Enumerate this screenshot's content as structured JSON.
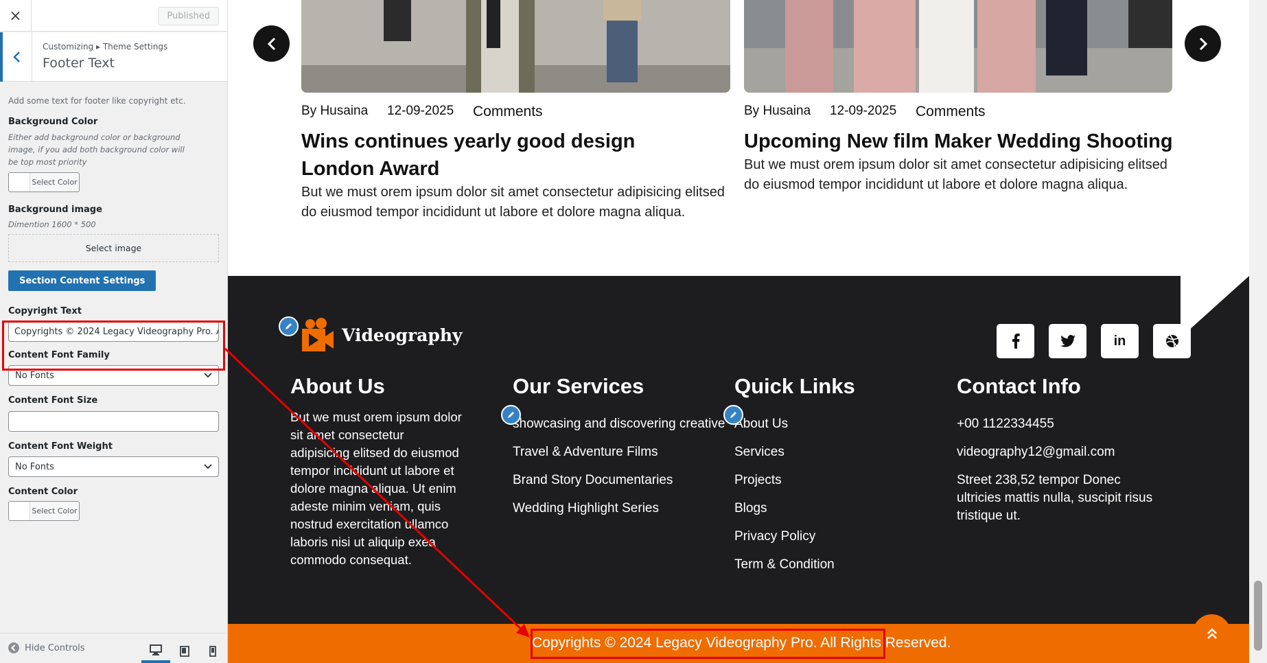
{
  "sidebar": {
    "close_label": "×",
    "publish_label": "Published",
    "breadcrumb": "Customizing ▸ Theme Settings",
    "section_title": "Footer Text",
    "description": "Add some text for footer like copyright etc.",
    "background_color": {
      "label": "Background Color",
      "note": "Either add background color or background image, if you add both background color will be top most priority",
      "button_label": "Select Color"
    },
    "background_image": {
      "label": "Background image",
      "note": "Dimention 1600 * 500",
      "button_label": "Select image"
    },
    "section_settings_button": "Section Content Settings",
    "copyright": {
      "label": "Copyright Text",
      "value": "Copyrights © 2024 Legacy Videography Pro. All Rights Reserved."
    },
    "font_family": {
      "label": "Content Font Family",
      "value": "No Fonts"
    },
    "font_size": {
      "label": "Content Font Size",
      "value": ""
    },
    "font_weight": {
      "label": "Content Font Weight",
      "value": "No Fonts"
    },
    "content_color": {
      "label": "Content Color",
      "button_label": "Select Color"
    },
    "hide_controls_label": "Hide Controls",
    "devices": [
      "desktop-icon",
      "tablet-icon",
      "mobile-icon"
    ]
  },
  "posts": [
    {
      "author": "By Husaina",
      "date": "12-09-2025",
      "comments": "Comments",
      "title": "Wins continues yearly good design London Award",
      "excerpt": "But we must orem ipsum dolor sit amet consectetur adipisicing elitsed do eiusmod tempor incididunt ut labore et dolore magna aliqua."
    },
    {
      "author": "By Husaina",
      "date": "12-09-2025",
      "comments": "Comments",
      "title": "Upcoming New film Maker Wedding Shooting",
      "excerpt": "But we must orem ipsum dolor sit amet consectetur adipisicing elitsed do eiusmod tempor incididunt ut labore et dolore magna aliqua."
    }
  ],
  "footer": {
    "logo_text": "Videography",
    "socials": [
      "facebook-icon",
      "twitter-icon",
      "linkedin-icon",
      "dribbble-icon"
    ],
    "about": {
      "heading": "About Us",
      "text": "But we must orem ipsum dolor sit amet consectetur adipisicing elitsed do eiusmod tempor incididunt ut labore et dolore magna aliqua. Ut enim adeste minim veniam, quis nostrud exercitation ullamco laboris nisi ut aliquip exea commodo consequat."
    },
    "services": {
      "heading": "Our Services",
      "items": [
        "showcasing and discovering creative",
        "Travel & Adventure Films",
        "Brand Story Documentaries",
        "Wedding Highlight Series"
      ]
    },
    "quick_links": {
      "heading": "Quick Links",
      "items": [
        "About Us",
        "Services",
        "Projects",
        "Blogs",
        "Privacy Policy",
        "Term & Condition"
      ]
    },
    "contact": {
      "heading": "Contact Info",
      "phone": "+00 1122334455",
      "email": "videography12@gmail.com",
      "address": "Street 238,52 tempor Donec ultricies mattis nulla, suscipit risus tristique ut."
    },
    "copyright": "Copyrights © 2024 Legacy Videography Pro. All Rights Reserved."
  },
  "colors": {
    "accent_orange": "#ef6c00",
    "footer_bg": "#1d1d1f",
    "wp_blue": "#2271b1",
    "highlight_red": "#e50000"
  }
}
